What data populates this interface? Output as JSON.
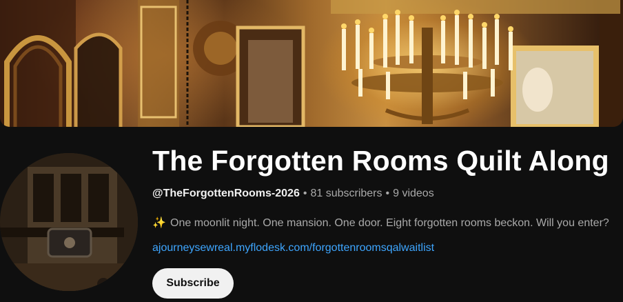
{
  "channel": {
    "title": "The Forgotten Rooms Quilt Along",
    "handle": "@TheForgottenRooms-2026",
    "separator": "•",
    "subscribers": "81 subscribers",
    "videos": "9 videos",
    "description_icon": "sparkles-icon",
    "description": "One moonlit night. One mansion. One door. Eight forgotten rooms beckon. Will you enter?",
    "link": "ajourneysewreal.myflodesk.com/forgottenroomsqalwaitlist",
    "subscribe_label": "Subscribe"
  },
  "colors": {
    "background": "#0f0f0f",
    "link": "#3ea6ff",
    "button_bg": "#f1f1f1",
    "secondary_text": "#aaaaaa"
  }
}
